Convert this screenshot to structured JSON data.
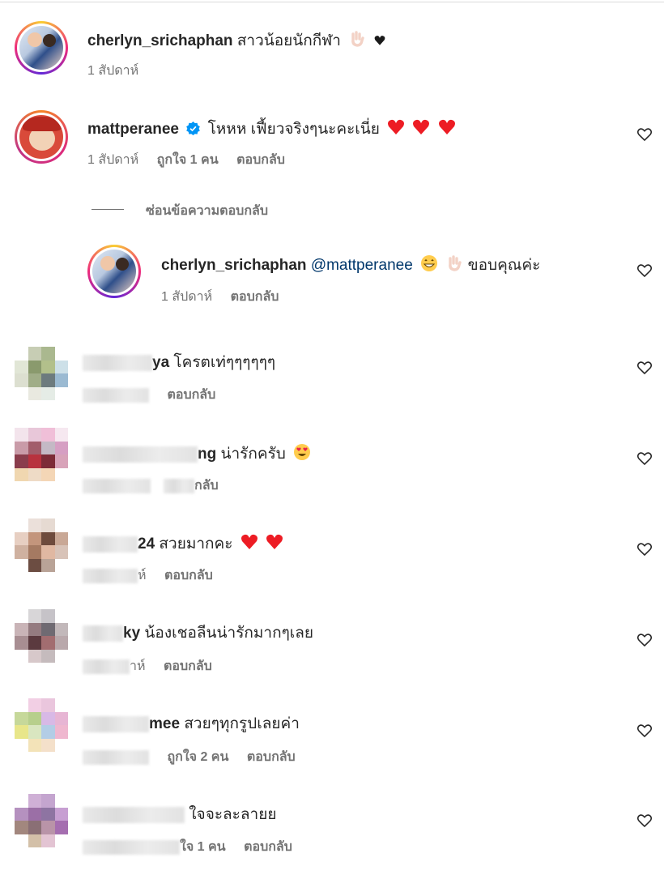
{
  "comments": [
    {
      "username": "cherlyn_srichaphan",
      "text": "สาวน้อยนักกีฬา",
      "time": "1 สัปดาห์",
      "likes": "",
      "reply": ""
    },
    {
      "username": "mattperanee",
      "text": "โหหห เฟี้ยวจริงๆนะคะเนี่ย",
      "time": "1 สัปดาห์",
      "likes": "ถูกใจ 1 คน",
      "reply": "ตอบกลับ"
    },
    {
      "username": "cherlyn_srichaphan",
      "mention": "@mattperanee",
      "text": "ขอบคุณค่ะ",
      "time": "1 สัปดาห์",
      "reply": "ตอบกลับ"
    },
    {
      "username_tail": "ya",
      "text": "โครตเท่ๆๆๆๆๆๆ",
      "reply": "ตอบกลับ"
    },
    {
      "username_tail": "ng",
      "text": "น่ารักครับ",
      "reply_tail": "กลับ"
    },
    {
      "username_tail": "24",
      "text": "สวยมากคะ",
      "time_tail": "ห์",
      "reply": "ตอบกลับ"
    },
    {
      "username_tail": "ky",
      "text": "น้องเชอลีนน่ารักมากๆเลย",
      "time_tail": "าห์",
      "reply": "ตอบกลับ"
    },
    {
      "username_tail": "mee",
      "text": "สวยๆทุกรูปเลยค่า",
      "likes": "ถูกใจ 2 คน",
      "reply": "ตอบกลับ"
    },
    {
      "username_tail": "",
      "text": "ใจจะละลายย",
      "likes_tail": "ใจ 1 คน",
      "reply": "ตอบกลับ"
    }
  ],
  "hide_replies": "ซ่อนข้อความตอบกลับ",
  "icons": {
    "like": "heart-outline-icon",
    "verified": "verified-badge-icon"
  },
  "colors": {
    "verified": "#0095f6",
    "mention": "#00376b",
    "heart_red": "#ed1c24"
  }
}
